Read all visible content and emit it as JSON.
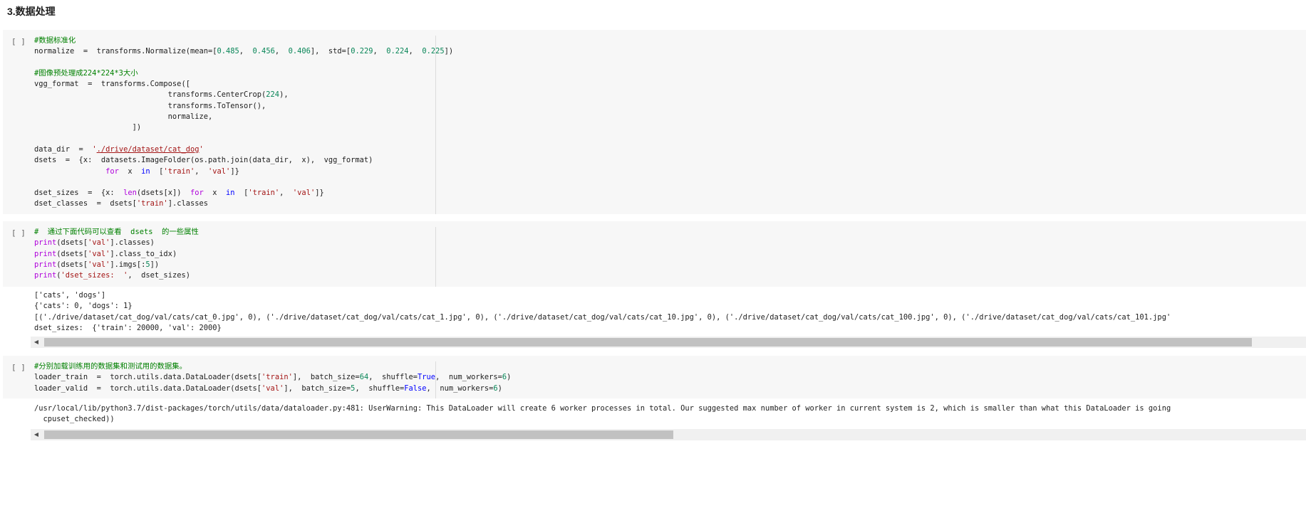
{
  "heading": "3.数据处理",
  "cells": [
    {
      "prompt": "[ ]",
      "lines": [
        [
          [
            "c",
            "#数据标准化"
          ]
        ],
        [
          [
            "",
            "normalize  =  transforms.Normalize(mean=["
          ],
          [
            "n",
            "0.485"
          ],
          [
            "",
            ",  "
          ],
          [
            "n",
            "0.456"
          ],
          [
            "",
            ",  "
          ],
          [
            "n",
            "0.406"
          ],
          [
            "",
            "],  std=["
          ],
          [
            "n",
            "0.229"
          ],
          [
            "",
            ",  "
          ],
          [
            "n",
            "0.224"
          ],
          [
            "",
            ",  "
          ],
          [
            "n",
            "0.225"
          ],
          [
            "",
            "])"
          ]
        ],
        [],
        [
          [
            "c",
            "#图像预处理成224*224*3大小"
          ]
        ],
        [
          [
            "",
            "vgg_format  =  transforms.Compose(["
          ]
        ],
        [
          [
            "",
            "                              transforms.CenterCrop("
          ],
          [
            "n",
            "224"
          ],
          [
            "",
            "),"
          ]
        ],
        [
          [
            "",
            "                              transforms.ToTensor(),"
          ]
        ],
        [
          [
            "",
            "                              normalize,"
          ]
        ],
        [
          [
            "",
            "                      ])"
          ]
        ],
        [],
        [
          [
            "",
            "data_dir  =  "
          ],
          [
            "s",
            "'"
          ],
          [
            "su",
            "./drive/dataset/cat_dog"
          ],
          [
            "s",
            "'"
          ]
        ],
        [
          [
            "",
            "dsets  =  {x:  datasets.ImageFolder(os.path.join(data_dir,  x),  vgg_format)"
          ]
        ],
        [
          [
            "",
            "                "
          ],
          [
            "k",
            "for"
          ],
          [
            "",
            "  x  "
          ],
          [
            "b",
            "in"
          ],
          [
            "",
            "  ["
          ],
          [
            "s",
            "'train'"
          ],
          [
            "",
            ",  "
          ],
          [
            "s",
            "'val'"
          ],
          [
            "",
            "]}"
          ]
        ],
        [],
        [
          [
            "",
            "dset_sizes  =  {x:  "
          ],
          [
            "k",
            "len"
          ],
          [
            "",
            "(dsets[x])  "
          ],
          [
            "k",
            "for"
          ],
          [
            "",
            "  x  "
          ],
          [
            "b",
            "in"
          ],
          [
            "",
            "  ["
          ],
          [
            "s",
            "'train'"
          ],
          [
            "",
            ",  "
          ],
          [
            "s",
            "'val'"
          ],
          [
            "",
            "]}"
          ]
        ],
        [
          [
            "",
            "dset_classes  =  dsets["
          ],
          [
            "s",
            "'train'"
          ],
          [
            "",
            "].classes"
          ]
        ]
      ]
    },
    {
      "prompt": "[ ]",
      "lines": [
        [
          [
            "c",
            "#  通过下面代码可以查看  dsets  的一些属性"
          ]
        ],
        [
          [
            "k",
            "print"
          ],
          [
            "",
            "(dsets["
          ],
          [
            "s",
            "'val'"
          ],
          [
            "",
            "].classes)"
          ]
        ],
        [
          [
            "k",
            "print"
          ],
          [
            "",
            "(dsets["
          ],
          [
            "s",
            "'val'"
          ],
          [
            "",
            "].class_to_idx)"
          ]
        ],
        [
          [
            "k",
            "print"
          ],
          [
            "",
            "(dsets["
          ],
          [
            "s",
            "'val'"
          ],
          [
            "",
            "].imgs[:"
          ],
          [
            "n",
            "5"
          ],
          [
            "",
            "])"
          ]
        ],
        [
          [
            "k",
            "print"
          ],
          [
            "",
            "("
          ],
          [
            "s",
            "'dset_sizes:  '"
          ],
          [
            "",
            ",  dset_sizes)"
          ]
        ]
      ],
      "output": [
        "['cats', 'dogs']",
        "{'cats': 0, 'dogs': 1}",
        "[('./drive/dataset/cat_dog/val/cats/cat_0.jpg', 0), ('./drive/dataset/cat_dog/val/cats/cat_1.jpg', 0), ('./drive/dataset/cat_dog/val/cats/cat_10.jpg', 0), ('./drive/dataset/cat_dog/val/cats/cat_100.jpg', 0), ('./drive/dataset/cat_dog/val/cats/cat_101.jpg'",
        "dset_sizes:  {'train': 20000, 'val': 2000}"
      ],
      "scroll_fraction": 0.96
    },
    {
      "prompt": "[ ]",
      "lines": [
        [
          [
            "c",
            "#分别加载训练用的数据集和测试用的数据集。"
          ]
        ],
        [
          [
            "",
            "loader_train  =  torch.utils.data.DataLoader(dsets["
          ],
          [
            "s",
            "'train'"
          ],
          [
            "",
            "],  batch_size="
          ],
          [
            "n",
            "64"
          ],
          [
            "",
            ",  shuffle="
          ],
          [
            "b",
            "True"
          ],
          [
            "",
            ",  num_workers="
          ],
          [
            "n",
            "6"
          ],
          [
            "",
            ")"
          ]
        ],
        [
          [
            "",
            "loader_valid  =  torch.utils.data.DataLoader(dsets["
          ],
          [
            "s",
            "'val'"
          ],
          [
            "",
            "],  batch_size="
          ],
          [
            "n",
            "5"
          ],
          [
            "",
            ",  shuffle="
          ],
          [
            "b",
            "False"
          ],
          [
            "",
            ",  num_workers="
          ],
          [
            "n",
            "6"
          ],
          [
            "",
            ")"
          ]
        ]
      ],
      "output": [
        "/usr/local/lib/python3.7/dist-packages/torch/utils/data/dataloader.py:481: UserWarning: This DataLoader will create 6 worker processes in total. Our suggested max number of worker in current system is 2, which is smaller than what this DataLoader is going",
        "  cpuset_checked))"
      ],
      "scroll_fraction": 0.5
    }
  ],
  "icons": {
    "scroll_left": "scroll-left-arrow-icon"
  }
}
